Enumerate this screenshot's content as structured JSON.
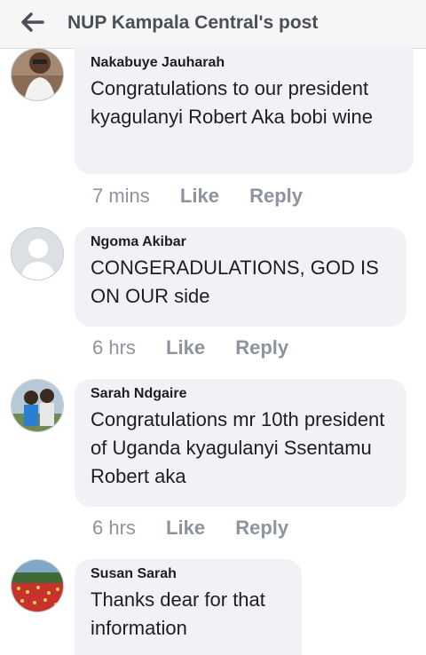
{
  "header": {
    "title": "NUP Kampala Central's post",
    "back_icon": "arrow-left-icon"
  },
  "comments": [
    {
      "author": "Nakabuye Jauharah",
      "text": "Congratulations to our president kyagulanyi Robert Aka bobi wine",
      "time": "7 mins",
      "like": "Like",
      "reply": "Reply",
      "avatar": "user-photo"
    },
    {
      "author": "Ngoma Akibar",
      "text": "CONGERADULATIONS,  GOD IS ON OUR side",
      "time": "6 hrs",
      "like": "Like",
      "reply": "Reply",
      "avatar": "default-profile-icon"
    },
    {
      "author": "Sarah Ndgaire",
      "text": "Congratulations mr 10th president of Uganda kyagulanyi Ssentamu Robert aka",
      "time": "6 hrs",
      "like": "Like",
      "reply": "Reply",
      "avatar": "user-photo"
    },
    {
      "author": "Susan Sarah",
      "text": "Thanks dear for that information",
      "avatar": "user-photo"
    }
  ],
  "colors": {
    "header_bg": "#f6f6f6",
    "bubble_bg": "#f0f2f5",
    "meta_text": "#8d949e",
    "title_text": "#4b4f56"
  }
}
